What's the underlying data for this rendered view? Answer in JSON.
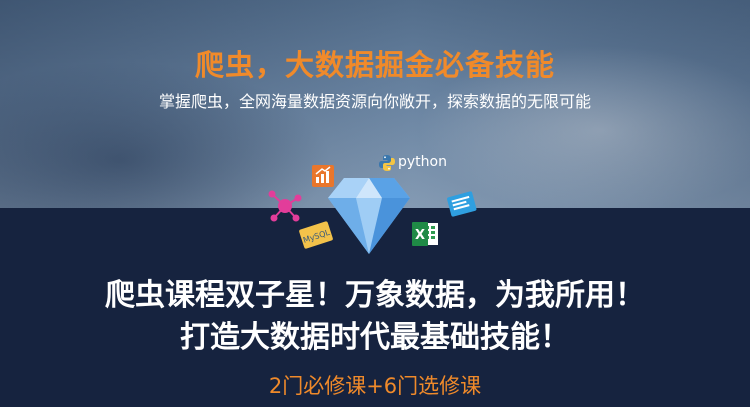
{
  "banner": {
    "title": "爬虫，大数据掘金必备技能",
    "subtitle": "掌握爬虫，全网海量数据资源向你敞开，探索数据的无限可能",
    "headline_line1": "爬虫课程双子星！万象数据，为我所用！",
    "headline_line2": "打造大数据时代最基础技能！",
    "courses": "2门必修课+6门选修课"
  },
  "icons": {
    "python_label": "python",
    "mysql_label": "MySQL",
    "excel_label": "X"
  },
  "colors": {
    "accent": "#f08a2a",
    "navy": "#16233f",
    "diamond": "#6fb4f0"
  }
}
